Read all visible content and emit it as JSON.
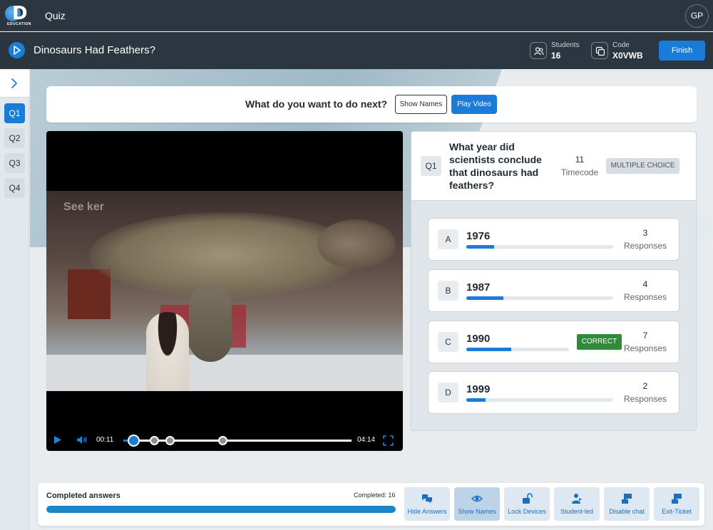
{
  "app": {
    "title": "Quiz",
    "logo_text": "EDUCATION",
    "user_initials": "GP"
  },
  "header": {
    "quiz_title": "Dinosaurs Had Feathers?",
    "students_label": "Students",
    "students_value": "16",
    "code_label": "Code",
    "code_value": "X0VWB",
    "finish_label": "Finish"
  },
  "sidebar": {
    "items": [
      "Q1",
      "Q2",
      "Q3",
      "Q4"
    ],
    "active": "Q1"
  },
  "next_bar": {
    "question": "What do you want to do next?",
    "show_names": "Show Names",
    "play_video": "Play Video"
  },
  "video": {
    "watermark": "See ker",
    "current_time": "00:11",
    "total_time": "04:14",
    "progress": 0.043,
    "markers": [
      0.043,
      0.134,
      0.203,
      0.433
    ]
  },
  "question": {
    "tag": "Q1",
    "text": "What year did scientists conclude that dinosaurs had feathers?",
    "timecode_value": "11",
    "timecode_label": "Timecode",
    "type": "MULTIPLE CHOICE",
    "answers": [
      {
        "letter": "A",
        "value": "1976",
        "count": "3",
        "responses_label": "Responses",
        "fraction": 0.19,
        "correct": false
      },
      {
        "letter": "B",
        "value": "1987",
        "count": "4",
        "responses_label": "Responses",
        "fraction": 0.25,
        "correct": false
      },
      {
        "letter": "C",
        "value": "1990",
        "count": "7",
        "responses_label": "Responses",
        "fraction": 0.44,
        "correct": true
      },
      {
        "letter": "D",
        "value": "1999",
        "count": "2",
        "responses_label": "Responses",
        "fraction": 0.13,
        "correct": false
      }
    ],
    "correct_label": "CORRECT"
  },
  "completion": {
    "label": "Completed answers",
    "count_text": "Completed: 16",
    "fraction": 1.0
  },
  "tools": [
    {
      "label": "Hide Answers",
      "icon": "chat-bubbles-icon",
      "active": false
    },
    {
      "label": "Show Names",
      "icon": "eye-icon",
      "active": true
    },
    {
      "label": "Lock Devices",
      "icon": "unlock-icon",
      "active": false
    },
    {
      "label": "Student-led",
      "icon": "student-icon",
      "active": false
    },
    {
      "label": "Disable chat",
      "icon": "chat-icon",
      "active": false
    },
    {
      "label": "Exit-Ticket",
      "icon": "ticket-icon",
      "active": false
    }
  ],
  "colors": {
    "accent": "#1a7cd8",
    "topbar": "#2b3640",
    "correct": "#2f8a3a"
  }
}
